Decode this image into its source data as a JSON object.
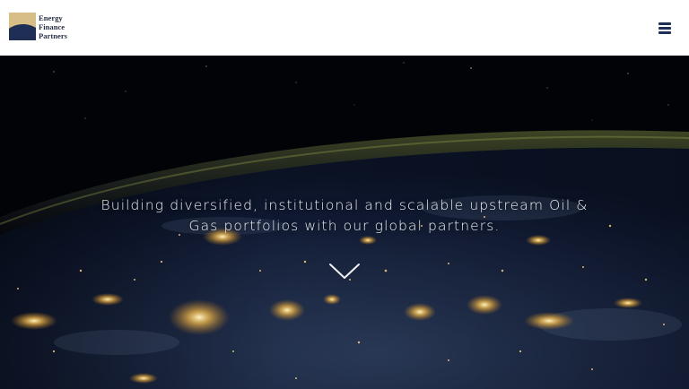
{
  "header": {
    "logo": {
      "line1": "Energy",
      "line2": "Finance",
      "line3": "Partners"
    },
    "menu_icon": "hamburger-menu-icon"
  },
  "hero": {
    "headline_line1": "Building diversified, institutional and scalable upstream Oil &",
    "headline_line2": "Gas portfolios with our global partners.",
    "scroll_icon": "chevron-down-icon"
  },
  "colors": {
    "navy": "#1f2e55",
    "gold": "#b89a5c",
    "hero_text": "#eef1f6"
  }
}
